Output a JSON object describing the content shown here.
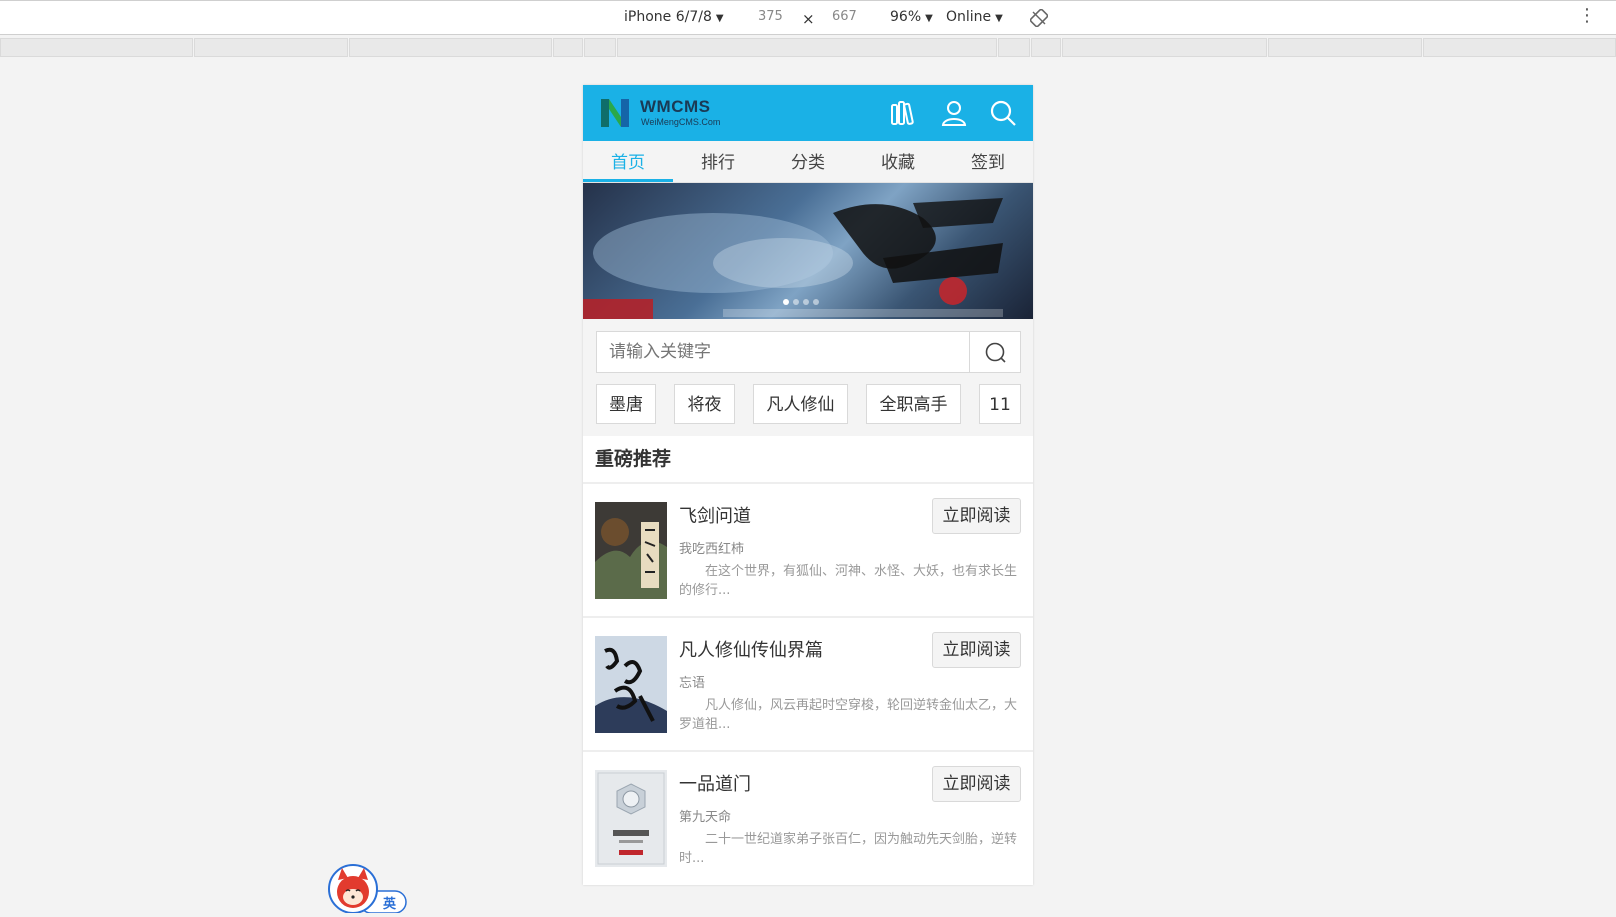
{
  "devtools": {
    "device": "iPhone 6/7/8",
    "width": "375",
    "times": "×",
    "height": "667",
    "zoom": "96%",
    "network": "Online",
    "rotate_icon": "rotate-icon",
    "more_icon": "more-vert-icon"
  },
  "app": {
    "logo_title": "WMCMS",
    "logo_sub": "WeiMengCMS.Com",
    "icons": [
      "bookshelf-icon",
      "user-icon",
      "search-icon"
    ],
    "accent": "#1ab1e6"
  },
  "tabs": [
    {
      "label": "首页",
      "active": true
    },
    {
      "label": "排行",
      "active": false
    },
    {
      "label": "分类",
      "active": false
    },
    {
      "label": "收藏",
      "active": false
    },
    {
      "label": "签到",
      "active": false
    }
  ],
  "search": {
    "placeholder": "请输入关键字"
  },
  "hot_tags": [
    "墨唐",
    "将夜",
    "凡人修仙",
    "全职高手",
    "11"
  ],
  "section_title": "重磅推荐",
  "books": [
    {
      "title": "飞剑问道",
      "author": "我吃西红柿",
      "desc": "在这个世界，有狐仙、河神、水怪、大妖，也有求长生的修行...",
      "button": "立即阅读"
    },
    {
      "title": "凡人修仙传仙界篇",
      "author": "忘语",
      "desc": "凡人修仙，风云再起时空穿梭，轮回逆转金仙太乙，大罗道祖...",
      "button": "立即阅读"
    },
    {
      "title": "一品道门",
      "author": "第九天命",
      "desc": "二十一世纪道家弟子张百仁，因为触动先天剑胎，逆转时...",
      "button": "立即阅读"
    }
  ],
  "ime_label": "英"
}
